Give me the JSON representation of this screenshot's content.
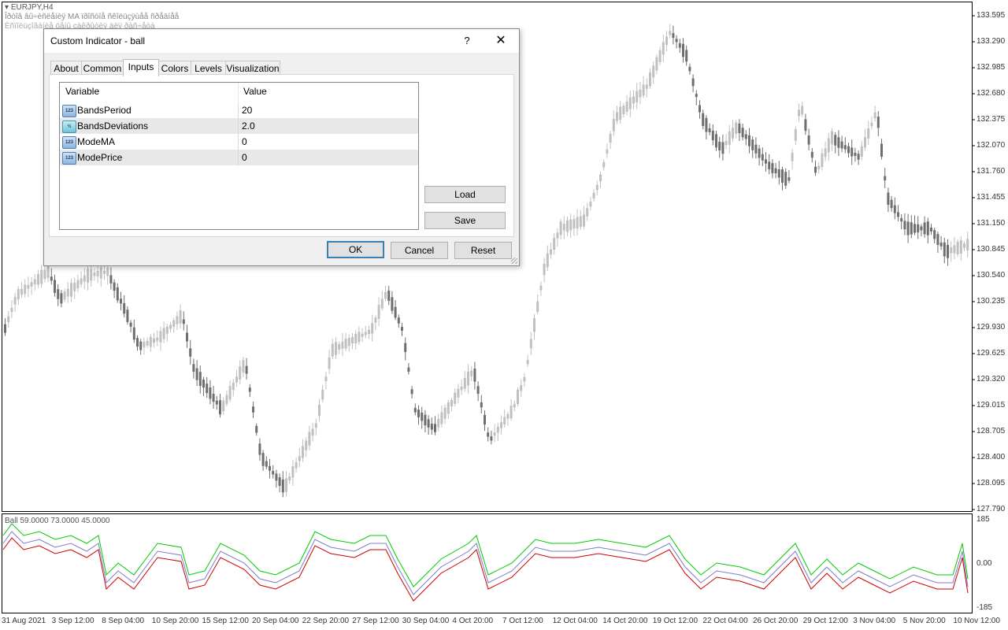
{
  "chart": {
    "symbol": "EURJPY,H4",
    "garble_line1": "Îðòîâ âû÷èñëåíèÿ MA ïðîñòîå ñêîëüçÿùåå ñðåäíåå",
    "garble_line2": "Èñïîëüçîâàíèå öåíû çàêðûòèÿ äëÿ ðàñ÷åòà",
    "price_axis": [
      "133.595",
      "133.290",
      "132.985",
      "132.680",
      "132.375",
      "132.070",
      "131.760",
      "131.455",
      "131.150",
      "130.845",
      "130.540",
      "130.235",
      "129.930",
      "129.625",
      "129.320",
      "129.015",
      "128.705",
      "128.400",
      "128.095",
      "127.790"
    ],
    "time_axis": [
      "31 Aug 2021",
      "3 Sep 12:00",
      "8 Sep 04:00",
      "10 Sep 20:00",
      "15 Sep 12:00",
      "20 Sep 04:00",
      "22 Sep 20:00",
      "27 Sep 12:00",
      "30 Sep 04:00",
      "4 Oct 20:00",
      "7 Oct 12:00",
      "12 Oct 04:00",
      "14 Oct 20:00",
      "19 Oct 12:00",
      "22 Oct 04:00",
      "26 Oct 20:00",
      "29 Oct 12:00",
      "3 Nov 04:00",
      "5 Nov 20:00",
      "10 Nov 12:00"
    ],
    "subwindow_title": "Ball 59.0000 73.0000 45.0000",
    "subwindow_axis": [
      "185",
      "0.00",
      "-185"
    ],
    "colors": {
      "up": "#c0c0c0",
      "down": "#6e6e6e",
      "green": "#00cc00",
      "red": "#cc0000",
      "blue": "#7c7ccc"
    }
  },
  "dialog": {
    "title": "Custom Indicator - ball",
    "help": "?",
    "close": "✕",
    "tabs": [
      "About",
      "Common",
      "Inputs",
      "Colors",
      "Levels",
      "Visualization"
    ],
    "active_tab": "Inputs",
    "columns": {
      "variable": "Variable",
      "value": "Value"
    },
    "rows": [
      {
        "icon": "123",
        "name": "BandsPeriod",
        "value": "20"
      },
      {
        "icon": "½",
        "name": "BandsDeviations",
        "value": "2.0"
      },
      {
        "icon": "123",
        "name": "ModeMA",
        "value": "0"
      },
      {
        "icon": "123",
        "name": "ModePrice",
        "value": "0"
      }
    ],
    "buttons": {
      "load": "Load",
      "save": "Save",
      "ok": "OK",
      "cancel": "Cancel",
      "reset": "Reset"
    }
  }
}
